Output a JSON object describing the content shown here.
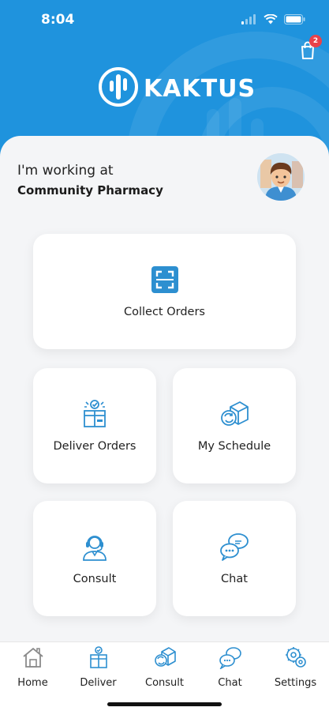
{
  "status_bar": {
    "time": "8:04"
  },
  "cart": {
    "badge_count": "2"
  },
  "brand": {
    "name": "KAKTUS"
  },
  "workplace": {
    "label": "I'm working at",
    "name": "Community Pharmacy"
  },
  "cards": {
    "collect": "Collect Orders",
    "deliver": "Deliver Orders",
    "schedule": "My Schedule",
    "consult": "Consult",
    "chat": "Chat"
  },
  "tabs": [
    "Home",
    "Deliver",
    "Consult",
    "Chat",
    "Settings"
  ],
  "colors": {
    "primary": "#1f93dd",
    "icon": "#2d8fd0",
    "badge": "#e8424a"
  },
  "icons": [
    "signal-icon",
    "wifi-icon",
    "battery-icon",
    "cart-icon",
    "kaktus-logo-icon",
    "scan-icon",
    "deliver-box-icon",
    "schedule-box-icon",
    "consult-agent-icon",
    "chat-bubbles-icon",
    "home-icon",
    "settings-icon"
  ]
}
